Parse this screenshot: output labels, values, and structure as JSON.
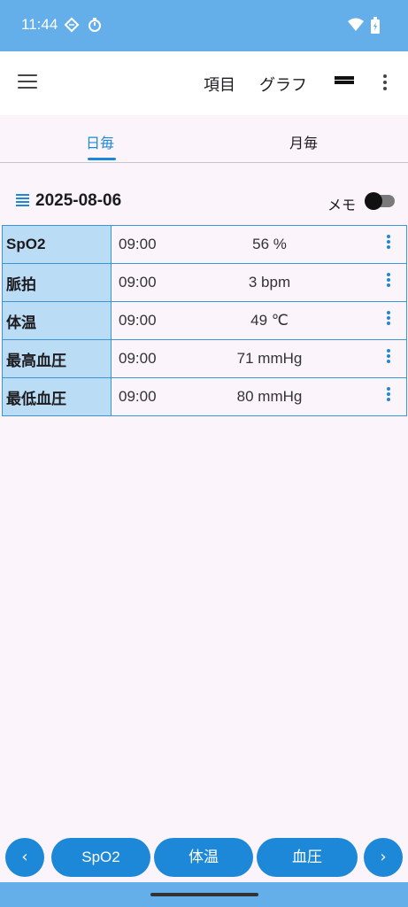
{
  "status_bar": {
    "time": "11:44"
  },
  "toolbar": {
    "items_label": "項目",
    "graph_label": "グラフ"
  },
  "tabs": [
    {
      "label": "日毎",
      "active": true
    },
    {
      "label": "月毎",
      "active": false
    }
  ],
  "date": "2025-08-06",
  "memo": {
    "label": "メモ",
    "enabled": false
  },
  "records": [
    {
      "name": "SpO2",
      "time": "09:00",
      "value": "56 %"
    },
    {
      "name": "脈拍",
      "time": "09:00",
      "value": "3 bpm"
    },
    {
      "name": "体温",
      "time": "09:00",
      "value": "49 ℃"
    },
    {
      "name": "最高血圧",
      "time": "09:00",
      "value": "71 mmHg"
    },
    {
      "name": "最低血圧",
      "time": "09:00",
      "value": "80 mmHg"
    }
  ],
  "bottom_nav": {
    "prev": "‹",
    "next": "›",
    "buttons": [
      "SpO2",
      "体温",
      "血圧"
    ]
  },
  "colors": {
    "accent": "#1e88d8",
    "status_bar": "#64aee9",
    "header_cell": "#bbdcf5",
    "background": "#fbf4fb"
  }
}
